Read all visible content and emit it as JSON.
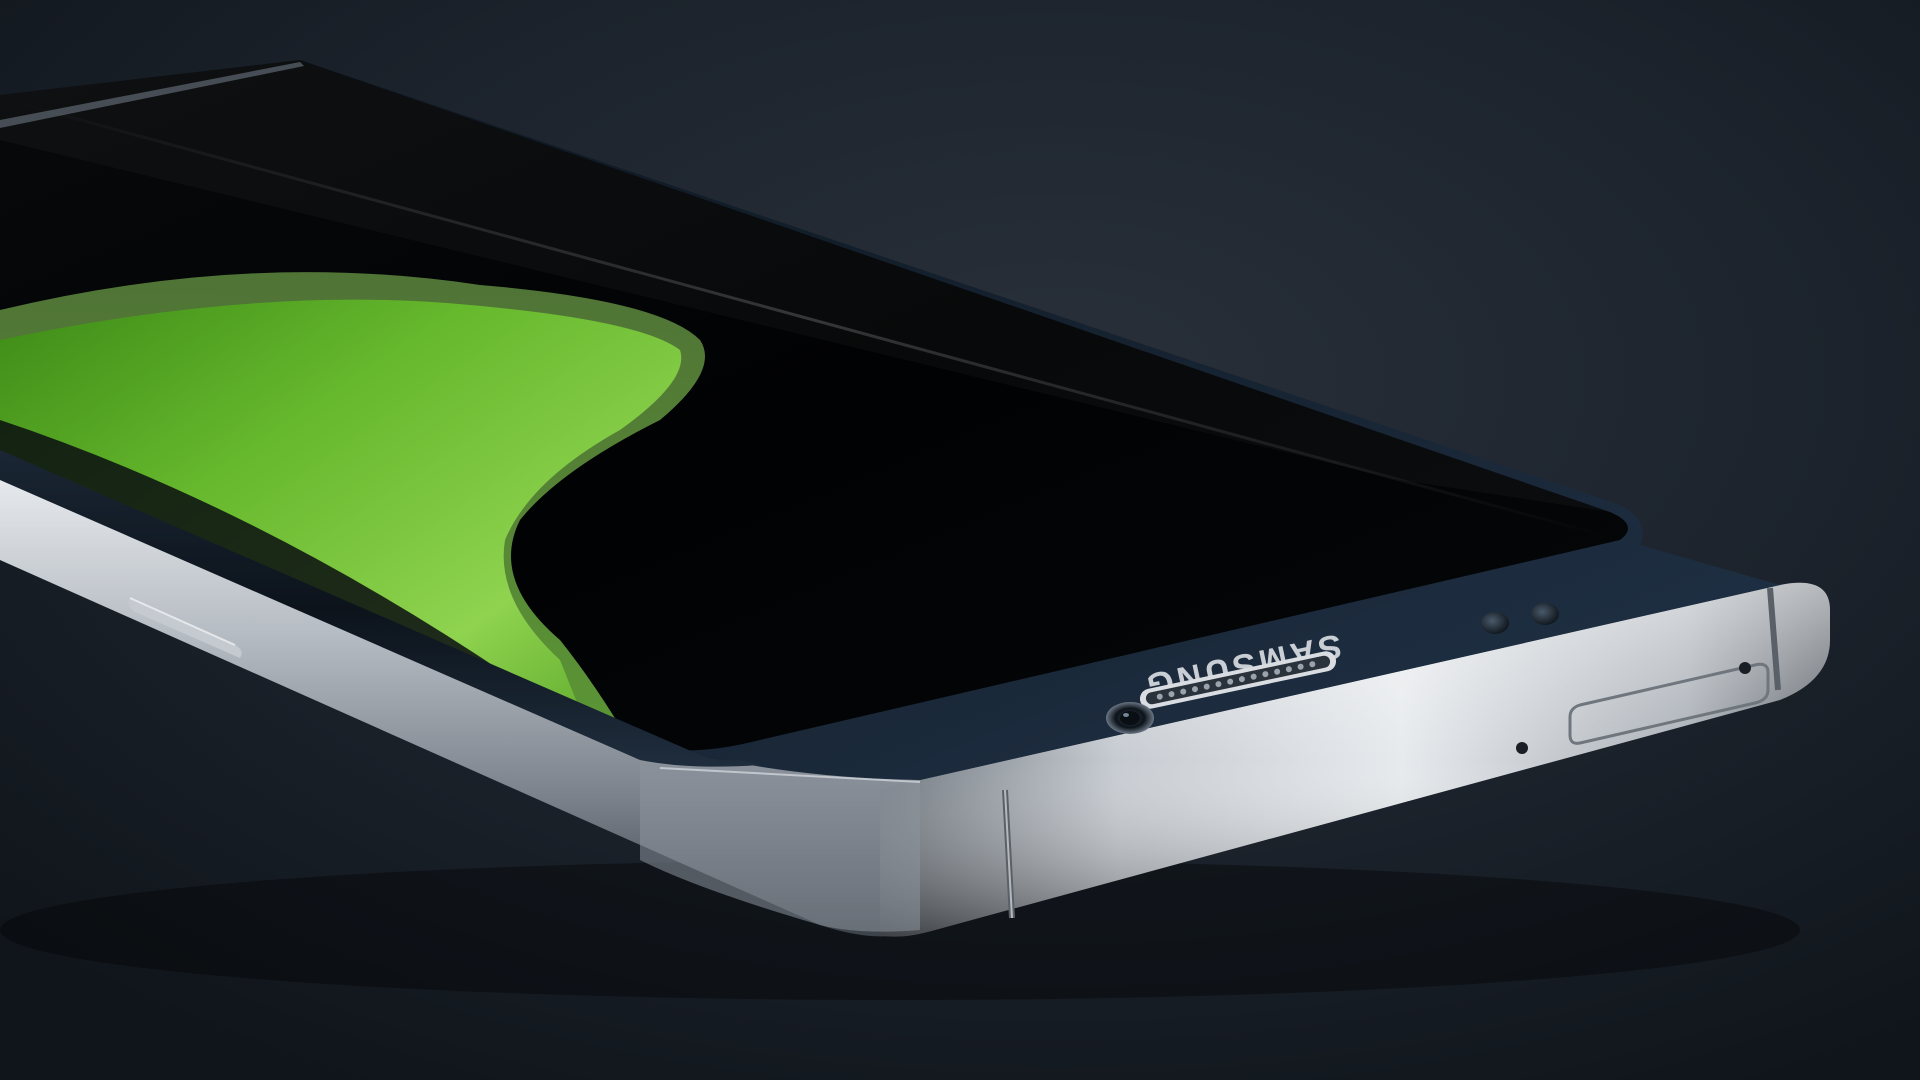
{
  "photo": {
    "subject": "smartphone-with-curved-edge-display",
    "brand_wordmark": "SAMSUNG",
    "colors": {
      "background": "#161c24",
      "background_glow": "#2a313b",
      "screen": "#020304",
      "front_glass": "#15212e",
      "wallpaper_green": "#5fb32a",
      "wallpaper_green_light": "#8fd34f",
      "metal_frame": "#9aa0a8",
      "metal_highlight": "#e6e9ec",
      "wordmark": "#c9ced4"
    }
  }
}
